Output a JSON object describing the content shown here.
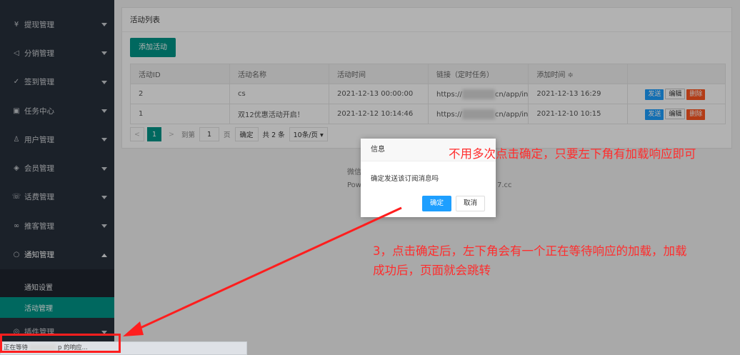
{
  "sidebar": {
    "items": [
      {
        "icon": "¥",
        "label": "提现管理"
      },
      {
        "icon": "◁",
        "label": "分销管理"
      },
      {
        "icon": "✓",
        "label": "签到管理"
      },
      {
        "icon": "▣",
        "label": "任务中心"
      },
      {
        "icon": "♙",
        "label": "用户管理"
      },
      {
        "icon": "◈",
        "label": "会员管理"
      },
      {
        "icon": "☏",
        "label": "话费管理"
      },
      {
        "icon": "∞",
        "label": "推客管理"
      },
      {
        "icon": "○",
        "label": "通知管理"
      }
    ],
    "sub_items": [
      "通知设置",
      "活动管理"
    ],
    "last_item": {
      "icon": "◎",
      "label": "插件管理"
    }
  },
  "panel": {
    "title": "活动列表",
    "add_button": "添加活动",
    "columns": [
      "活动ID",
      "活动名称",
      "活动时间",
      "链接（定时任务）",
      "添加时间 ≑",
      ""
    ],
    "rows": [
      {
        "id": "2",
        "name": "cs",
        "time": "2021-12-13 00:00:00",
        "link_prefix": "https://",
        "link_suffix": "cn/app/in",
        "added": "2021-12-13 16:29"
      },
      {
        "id": "1",
        "name": "双12优惠活动开启！",
        "time": "2021-12-12 10:14:46",
        "link_prefix": "https://",
        "link_suffix": "cn/app/in",
        "added": "2021-12-10 10:15"
      }
    ],
    "row_actions": {
      "send": "发送",
      "edit": "编辑",
      "delete": "删除"
    },
    "pager": {
      "prev": "<",
      "current": "1",
      "next": ">",
      "goto": "到第",
      "page_value": "1",
      "page_unit": "页",
      "confirm": "确定",
      "total": "共 2 条",
      "page_size": "10条/页 ▾"
    }
  },
  "footer": {
    "line1": "微信",
    "line2_prefix": "Pow",
    "line2_suffix": "7.cc"
  },
  "dialog": {
    "title": "信息",
    "message": "确定发送该订阅消息吗",
    "ok": "确定",
    "cancel": "取消"
  },
  "annotations": {
    "note1": "不用多次点击确定，只要左下角有加载响应即可",
    "note2": "3，点击确定后，左下角会有一个正在等待响应的加载，加载成功后，页面就会跳转"
  },
  "status_bar": {
    "prefix": "正在等待",
    "suffix": "p 的响应..."
  },
  "colors": {
    "sidebar": "#28303c",
    "accent": "#009688",
    "primary": "#1e9fff",
    "danger": "#ff5722",
    "annotation": "#ff1e1e"
  }
}
